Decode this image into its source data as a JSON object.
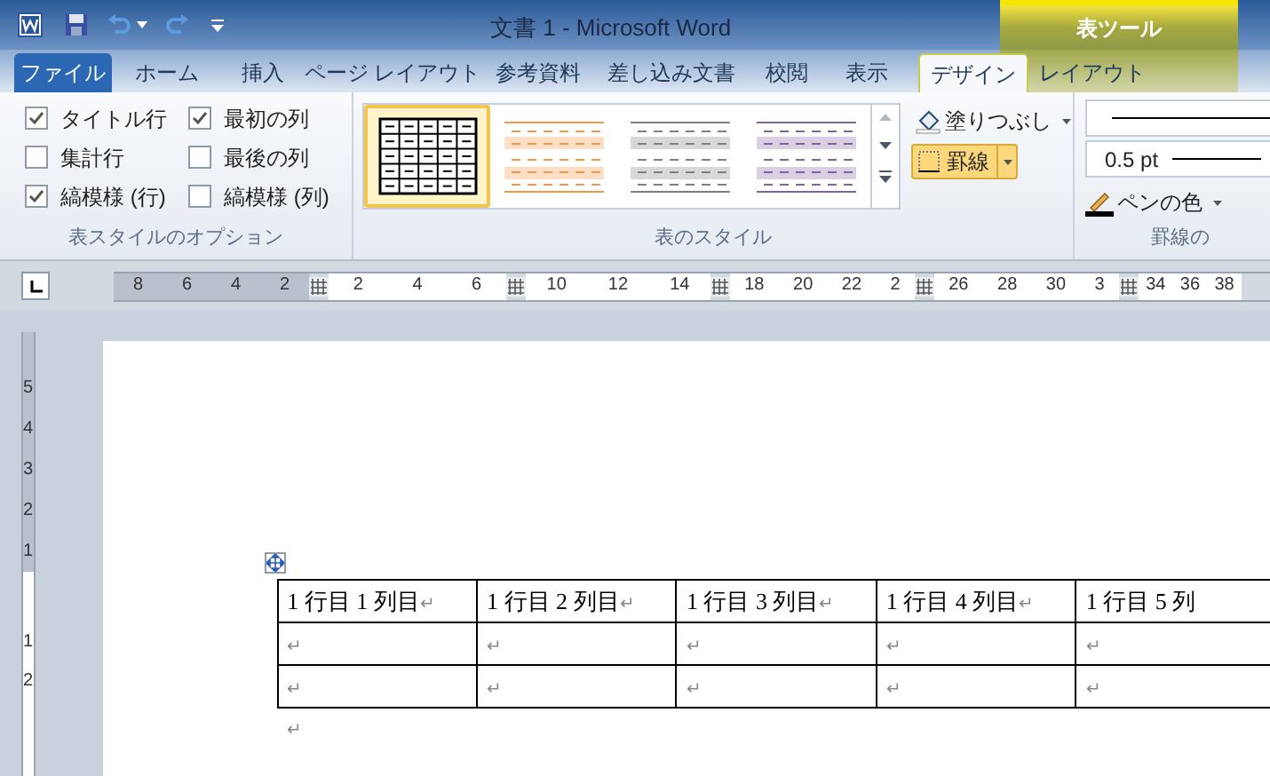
{
  "window": {
    "title": "文書 1 - Microsoft Word"
  },
  "context_header": "表ツール",
  "tabs": [
    {
      "label": "ファイル",
      "kind": "file",
      "selected": false
    },
    {
      "label": "ホーム",
      "kind": "normal",
      "selected": false
    },
    {
      "label": "挿入",
      "kind": "normal",
      "selected": false
    },
    {
      "label": "ページ レイアウト",
      "kind": "normal",
      "selected": false
    },
    {
      "label": "参考資料",
      "kind": "normal",
      "selected": false
    },
    {
      "label": "差し込み文書",
      "kind": "normal",
      "selected": false
    },
    {
      "label": "校閲",
      "kind": "normal",
      "selected": false
    },
    {
      "label": "表示",
      "kind": "normal",
      "selected": false
    },
    {
      "label": "デザイン",
      "kind": "context",
      "selected": true
    },
    {
      "label": "レイアウト",
      "kind": "context",
      "selected": false
    }
  ],
  "ribbon": {
    "style_options": {
      "options": [
        {
          "label": "タイトル行",
          "checked": true
        },
        {
          "label": "集計行",
          "checked": false
        },
        {
          "label": "縞模様 (行)",
          "checked": true
        },
        {
          "label": "最初の列",
          "checked": true
        },
        {
          "label": "最後の列",
          "checked": false
        },
        {
          "label": "縞模様 (列)",
          "checked": false
        }
      ],
      "group_label": "表スタイルのオプション"
    },
    "table_styles": {
      "styles": [
        {
          "kind": "grid",
          "color": "#000000",
          "selected": true
        },
        {
          "kind": "banded",
          "color": "#f79646",
          "selected": false
        },
        {
          "kind": "banded",
          "color": "#7f7f7f",
          "selected": false
        },
        {
          "kind": "banded",
          "color": "#8064a2",
          "selected": false
        }
      ],
      "shading_button": "塗りつぶし",
      "borders_button": {
        "label": "罫線",
        "on": true
      },
      "group_label": "表のスタイル"
    },
    "borders": {
      "line_weight": "0.5 pt",
      "pen_color_button": "ペンの色",
      "group_label": "罫線の"
    }
  },
  "ruler": {
    "segments": [
      {
        "kind": "margin",
        "labels": [
          "8",
          "6",
          "4",
          "2"
        ]
      },
      {
        "kind": "column",
        "labels": [
          "2",
          "4",
          "6"
        ]
      },
      {
        "kind": "column",
        "labels": [
          "10",
          "12",
          "14"
        ]
      },
      {
        "kind": "column",
        "labels": [
          "18",
          "20",
          "22",
          "2"
        ]
      },
      {
        "kind": "column",
        "labels": [
          "26",
          "28",
          "30",
          "3"
        ]
      },
      {
        "kind": "column",
        "labels": [
          "34",
          "36",
          "38"
        ]
      }
    ]
  },
  "vertical_ruler": {
    "top_labels": [
      "5",
      "4",
      "3",
      "2",
      "1"
    ],
    "bottom_labels": [
      "1",
      "2"
    ]
  },
  "document": {
    "table": {
      "rows": [
        [
          {
            "text": "1 行目 1 列目",
            "mark": "↵"
          },
          {
            "text": "1 行目 2 列目",
            "mark": "↵"
          },
          {
            "text": "1 行目 3 列目",
            "mark": "↵"
          },
          {
            "text": "1 行目 4 列目",
            "mark": "↵"
          },
          {
            "text": "1 行目 5 列"
          }
        ],
        [
          {
            "mark": "↵"
          },
          {
            "mark": "↵"
          },
          {
            "mark": "↵"
          },
          {
            "mark": "↵"
          },
          {
            "mark": "↵"
          }
        ],
        [
          {
            "mark": "↵"
          },
          {
            "mark": "↵"
          },
          {
            "mark": "↵"
          },
          {
            "mark": "↵"
          },
          {
            "mark": "↵"
          }
        ]
      ]
    },
    "end_mark": "↵"
  }
}
